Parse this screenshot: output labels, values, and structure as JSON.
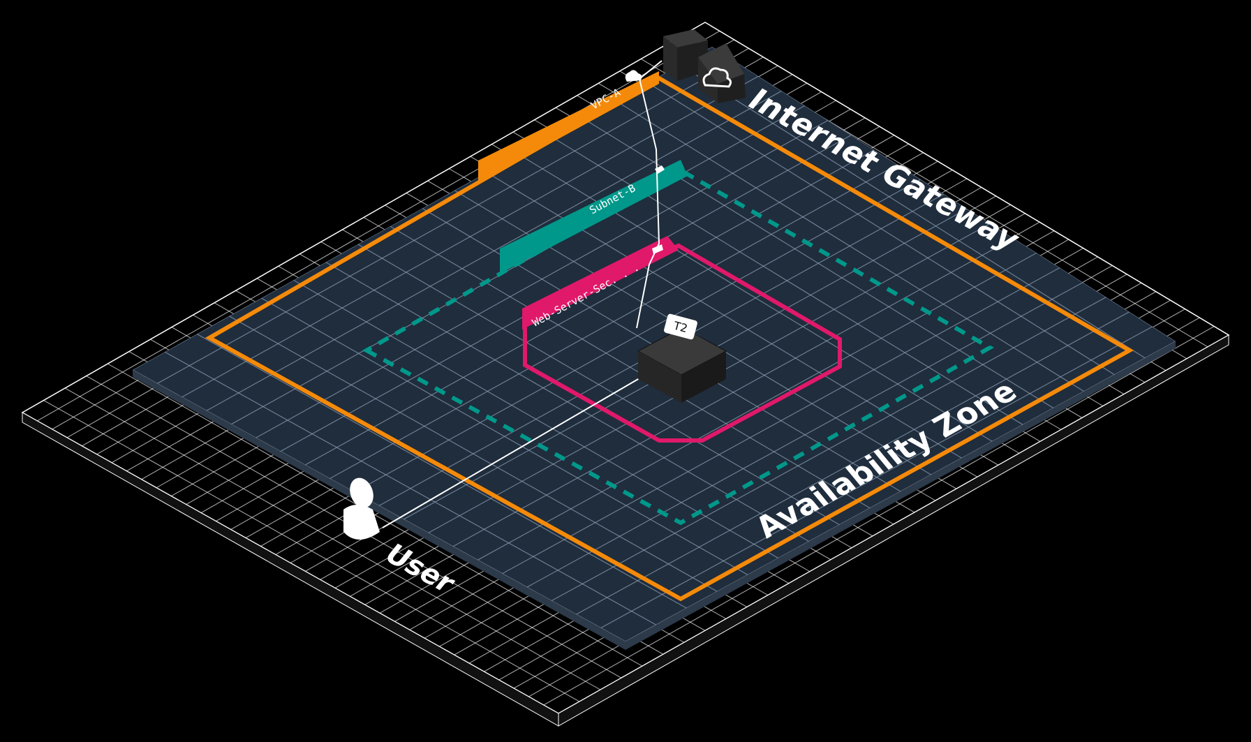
{
  "diagram": {
    "vpc": {
      "label": "VPC-A",
      "color": "#F58A0A"
    },
    "subnet": {
      "label": "Subnet-B",
      "color": "#00988A"
    },
    "security_group": {
      "label": "Web-Server-Sec. . .",
      "color": "#E0196A"
    },
    "availability_zone": {
      "label": "Availability Zone"
    },
    "internet_gateway": {
      "label": "Internet Gateway"
    },
    "instance": {
      "label": "T2"
    },
    "user": {
      "label": "User"
    },
    "colors": {
      "background": "#000000",
      "plate_top": "#1F2D3D",
      "grid": "#8A9AAD",
      "outer_grid": "#FFFFFF",
      "connector": "#FFFFFF"
    }
  }
}
